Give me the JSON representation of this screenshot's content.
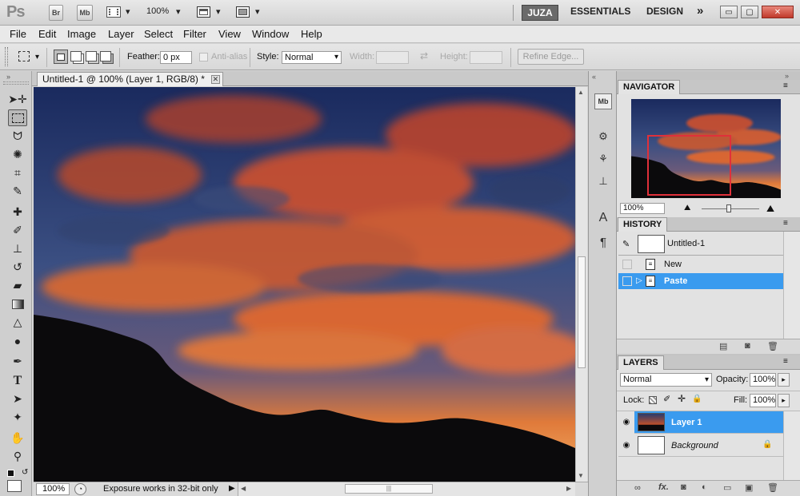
{
  "app": {
    "logo": "Ps",
    "br_button": "Br",
    "mb_button": "Mb",
    "zoom": "100%",
    "workspaces": [
      "JUZA",
      "ESSENTIALS",
      "DESIGN"
    ],
    "more_workspaces": "»",
    "window_controls": {
      "minimize": "▭",
      "restore": "▢",
      "close": "✕"
    }
  },
  "menu": [
    "File",
    "Edit",
    "Image",
    "Layer",
    "Select",
    "Filter",
    "View",
    "Window",
    "Help"
  ],
  "options": {
    "feather_label": "Feather:",
    "feather_value": "0 px",
    "antialias_label": "Anti-alias",
    "style_label": "Style:",
    "style_value": "Normal",
    "width_label": "Width:",
    "height_label": "Height:",
    "refine_edge": "Refine Edge..."
  },
  "document": {
    "tab_title": "Untitled-1 @ 100% (Layer 1, RGB/8) *",
    "close_glyph": "✕"
  },
  "status": {
    "zoom": "100%",
    "message": "Exposure works in 32-bit only"
  },
  "navigator": {
    "title": "NAVIGATOR",
    "zoom": "100%"
  },
  "history": {
    "title": "HISTORY",
    "snapshot": "Untitled-1",
    "steps": [
      {
        "label": "New",
        "selected": false
      },
      {
        "label": "Paste",
        "selected": true
      }
    ]
  },
  "layers": {
    "title": "LAYERS",
    "blend_mode": "Normal",
    "opacity_label": "Opacity:",
    "opacity_value": "100%",
    "lock_label": "Lock:",
    "fill_label": "Fill:",
    "fill_value": "100%",
    "items": [
      {
        "name": "Layer 1",
        "selected": true
      },
      {
        "name": "Background",
        "selected": false,
        "locked": true
      }
    ],
    "footer_fx": "fx."
  },
  "colors": {
    "selection": "#3a9bef",
    "nav_viewbox": "#e0303a"
  },
  "icons": [
    "move-icon",
    "marquee-icon",
    "lasso-icon",
    "quick-select-icon",
    "crop-icon",
    "eyedropper-icon",
    "healing-icon",
    "brush-icon",
    "stamp-icon",
    "history-brush-icon",
    "eraser-icon",
    "gradient-icon",
    "blur-icon",
    "dodge-icon",
    "pen-icon",
    "type-icon",
    "path-select-icon",
    "shape-icon",
    "hand-icon",
    "zoom-icon"
  ]
}
